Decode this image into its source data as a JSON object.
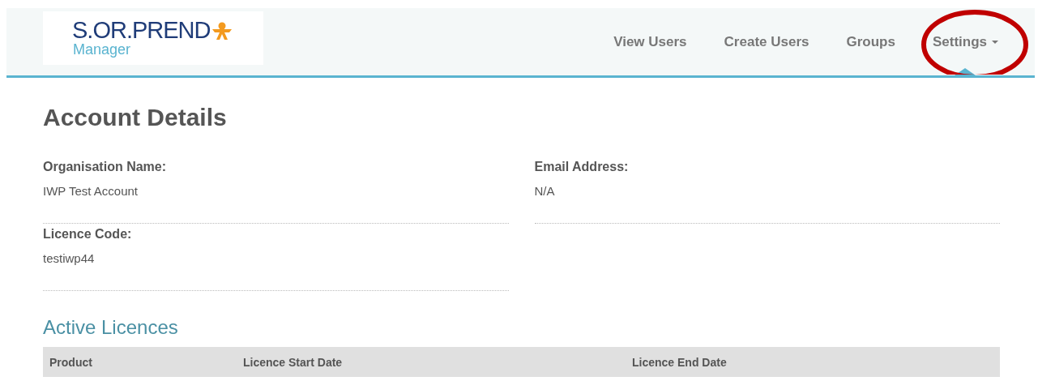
{
  "header": {
    "logo": {
      "name": "S.OR.PREND",
      "subtitle": "Manager"
    },
    "nav": [
      {
        "label": "View Users",
        "selected": false,
        "dropdown": false
      },
      {
        "label": "Create Users",
        "selected": false,
        "dropdown": false
      },
      {
        "label": "Groups",
        "selected": false,
        "dropdown": false
      },
      {
        "label": "Settings",
        "selected": true,
        "dropdown": true
      }
    ],
    "annotation": {
      "kind": "ellipse",
      "color": "#c00000"
    }
  },
  "title": "Account Details",
  "fields": [
    {
      "label": "Organisation Name:",
      "value": "IWP Test Account"
    },
    {
      "label": "Email Address:",
      "value": "N/A"
    },
    {
      "label": "Licence Code:",
      "value": "testiwp44"
    }
  ],
  "licences": {
    "heading": "Active Licences",
    "columns": [
      "Product",
      "Licence Start Date",
      "Licence End Date"
    ]
  }
}
